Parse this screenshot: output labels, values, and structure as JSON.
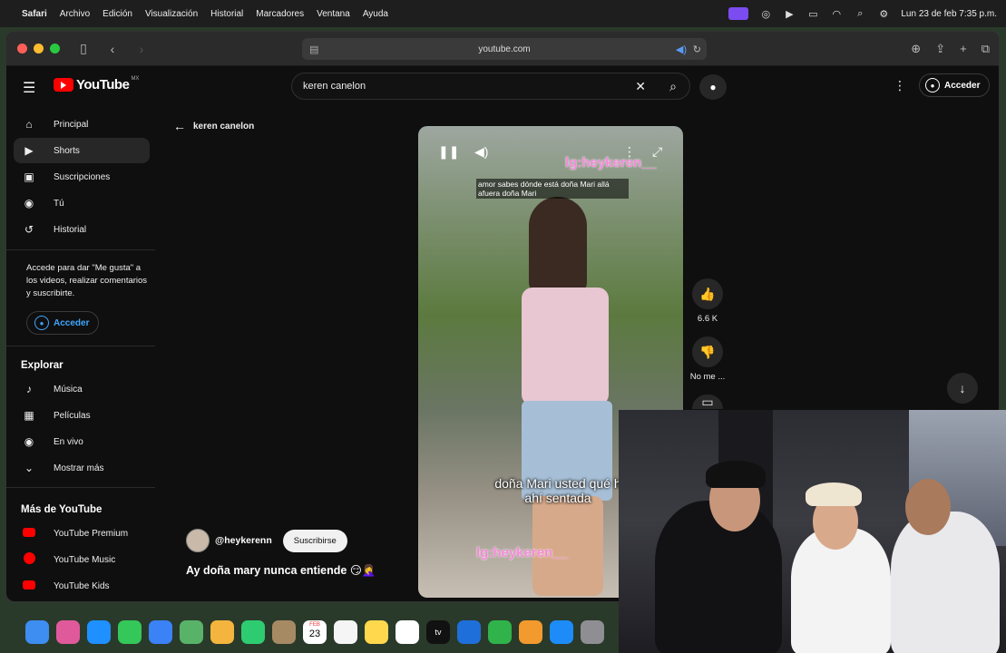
{
  "menubar": {
    "app": "Safari",
    "items": [
      "Archivo",
      "Edición",
      "Visualización",
      "Historial",
      "Marcadores",
      "Ventana",
      "Ayuda"
    ],
    "datetime": "Lun 23 de feb  7:35 p.m."
  },
  "browser": {
    "url": "youtube.com"
  },
  "youtube": {
    "logo_text": "YouTube",
    "country_code": "MX",
    "search_value": "keren canelon",
    "signin_label": "Acceder"
  },
  "sidebar": {
    "main_items": [
      {
        "label": "Principal",
        "icon": "home-icon"
      },
      {
        "label": "Shorts",
        "icon": "shorts-icon"
      },
      {
        "label": "Suscripciones",
        "icon": "subscriptions-icon"
      },
      {
        "label": "Tú",
        "icon": "you-icon"
      },
      {
        "label": "Historial",
        "icon": "history-icon"
      }
    ],
    "signin_note": "Accede para dar \"Me gusta\" a los videos, realizar comentarios y suscribirte.",
    "signin_label": "Acceder",
    "explore_heading": "Explorar",
    "explore_items": [
      {
        "label": "Música",
        "icon": "music-icon"
      },
      {
        "label": "Películas",
        "icon": "movies-icon"
      },
      {
        "label": "En vivo",
        "icon": "live-icon"
      },
      {
        "label": "Mostrar más",
        "icon": "chevron-down-icon"
      }
    ],
    "more_heading": "Más de YouTube",
    "more_items": [
      {
        "label": "YouTube Premium",
        "icon": "youtube-premium-icon"
      },
      {
        "label": "YouTube Music",
        "icon": "youtube-music-icon"
      },
      {
        "label": "YouTube Kids",
        "icon": "youtube-kids-icon"
      }
    ]
  },
  "main": {
    "back_label": "keren canelon",
    "video": {
      "caption": "amor sabes dónde está doña Mari allá afuera doña Mari",
      "watermark_top": "lg:heykeren__",
      "watermark_bottom": "lg:heykeren__",
      "subtitle_line1": "doña Mari usted qué h",
      "subtitle_line2": "ahí sentada"
    },
    "likes": "6.6 K",
    "dislike_label": "No me ...",
    "channel_name": "@heykerenn",
    "subscribe_label": "Suscribirse",
    "video_title": "Ay doña mary nunca entiende 😏🤦‍♀️"
  },
  "dock": {
    "calendar_month": "FEB",
    "calendar_day": "23",
    "tv_label": "tv"
  }
}
